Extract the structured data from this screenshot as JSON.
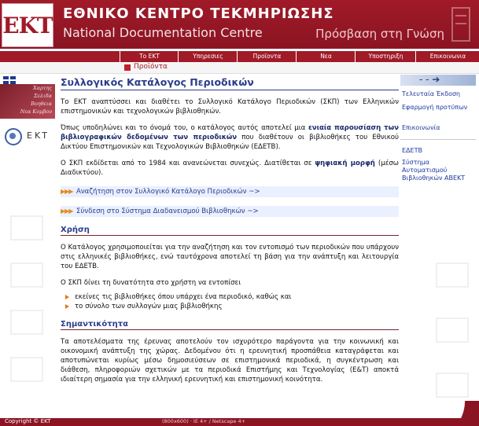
{
  "header": {
    "logo_text": "EKT",
    "title_gr": "ΕΘΝΙΚΟ ΚΕΝΤΡΟ ΤΕΚΜΗΡΙΩΣΗΣ",
    "title_en": "National Documentation Centre",
    "motto": "Πρόσβαση στη Γνώση"
  },
  "nav": {
    "items": [
      "Το ΕΚΤ",
      "Υπηρεσιες",
      "Προϊοντα",
      "Νεα",
      "Υποστηριξη",
      "Επικοινωνια"
    ]
  },
  "subnav": {
    "label": "Προϊόντα"
  },
  "left_menu": {
    "items": [
      "Χαρτης",
      "Σελιδα",
      "Βοηθεια",
      "Νεα Κομβου"
    ],
    "badge_text": "EKT"
  },
  "main": {
    "title": "Συλλογικός Κατάλογος Περιοδικών",
    "p1": "Το ΕΚΤ αναπτύσσει και διαθέτει το Συλλογικό Κατάλογο Περιοδικών (ΣΚΠ) των Ελληνικών επιστημονικών και τεχνολογικών βιβλιοθηκών.",
    "p2_a": "Όπως υποδηλώνει και το όνομά του, ο κατάλογος αυτός αποτελεί μια ",
    "p2_b": "ενιαία παρουσίαση των βιβλιογραφικών δεδομένων των περιοδικών",
    "p2_c": " που διαθέτουν οι βιβλιοθήκες του Εθνικού Δικτύου Επιστημονικών και Τεχνολογικών Βιβλιοθηκών (ΕΔΕΤΒ).",
    "p3_a": "Ο ΣΚΠ εκδίδεται από το 1984 και ανανεώνεται συνεχώς. Διατίθεται σε ",
    "p3_b": "ψηφιακή μορφή",
    "p3_c": " (μέσω Διαδικτύου).",
    "link1": "Αναζήτηση στον Συλλογικό Κατάλογο Περιοδικών ~>",
    "link2": "Σύνδεση στο Σύστημα Διαδανεισμού Βιβλιοθηκών ~>",
    "h_usage": "Χρήση",
    "p4": "Ο Κατάλογος χρησιμοποιείται για την αναζήτηση και τον εντοπισμό των περιοδικών που υπάρχουν στις ελληνικές βιβλιοθήκες, ενώ ταυτόχρονα αποτελεί τη βάση για την ανάπτυξη και λειτουργία του ΕΔΕΤΒ.",
    "p5": "Ο ΣΚΠ δίνει τη δυνατότητα στο χρήστη να εντοπίσει",
    "bullets": [
      "εκείνες τις βιβλιοθήκες όπου υπάρχει ένα περιοδικό, καθώς και",
      "το σύνολο των συλλογών μιας βιβλιοθήκης"
    ],
    "h_importance": "Σημαντικότητα",
    "p6": "Τα αποτελέσματα της έρευνας αποτελούν τον ισχυρότερο παράγοντα για την κοινωνική και οικονομική ανάπτυξη της χώρας. Δεδομένου ότι η ερευνητική προσπάθεια καταγράφεται και αποτυπώνεται κυρίως μέσω δημοσιεύσεων σε επιστημονικά περιοδικά, η συγκέντρωση και διάθεση, πληροφοριών σχετικών με τα περιοδικά Επιστήμης και Τεχνολογίας (Ε&Τ) αποκτά ιδιαίτερη σημασία για την ελληνική ερευνητική και επιστημονική κοινότητα."
  },
  "right": {
    "links": [
      "Τελευταία Έκδοση",
      "Εφαρμογή προτύπων",
      "Επικοινωνία",
      "ΕΔΕΤΒ",
      "Σύστημα Αυτοματισμού Βιβλιοθηκών ΑΒΕΚΤ"
    ]
  },
  "footer": {
    "copyright": "Copyright © EKT",
    "info": "(800x600) · IE 4+ / Netscape 4+"
  }
}
